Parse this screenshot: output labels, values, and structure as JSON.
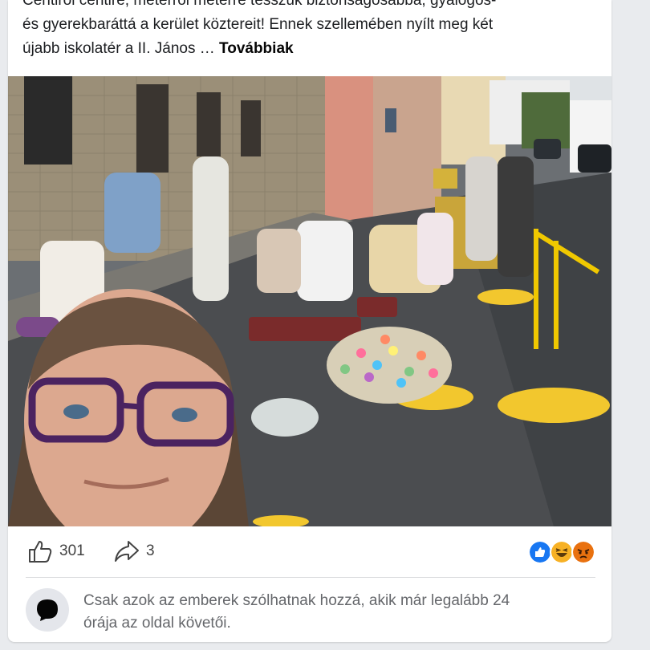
{
  "post": {
    "text_line1": "Centiről centire, méterről méterre tesszük biztonságosabbá, gyalogos-",
    "text_line2": "és gyerekbaráttá a kerület köztereit! Ennek szellemében nyílt meg két",
    "text_line3": "újabb iskolatér a II. János … ",
    "see_more": "Továbbiak"
  },
  "stats": {
    "likes_count": "301",
    "shares_count": "3",
    "reaction_icons": [
      "like-icon",
      "haha-icon",
      "angry-icon"
    ],
    "reaction_colors": {
      "like": "#1877f2",
      "haha": "#f7b125",
      "angry": "#e9710f"
    }
  },
  "comment": {
    "restriction_text_line1": "Csak azok az emberek szólhatnak hozzá, akik már legalább 24",
    "restriction_text_line2": "órája az oldal követői."
  }
}
